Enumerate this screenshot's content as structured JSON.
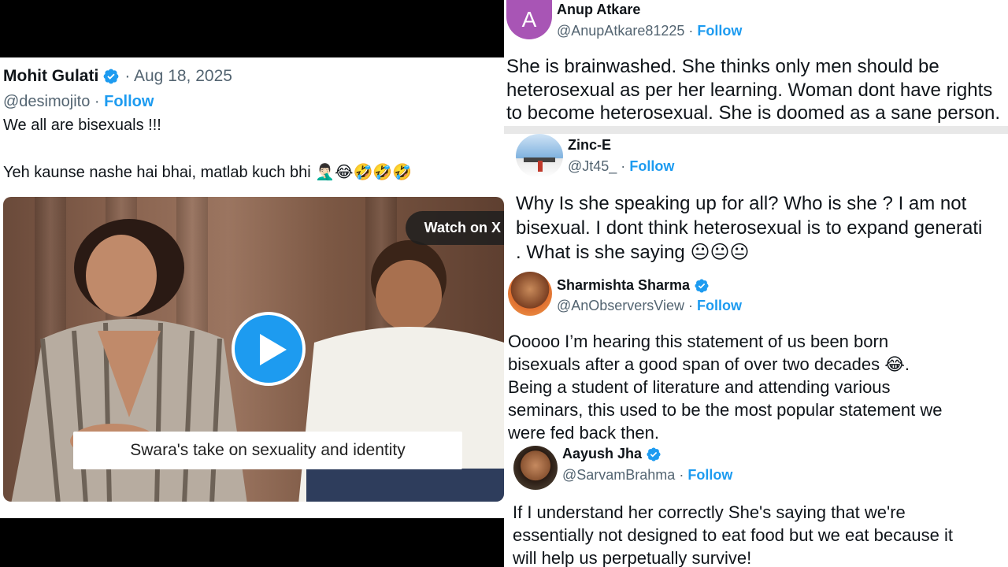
{
  "main_tweet": {
    "author": "Mohit Gulati",
    "date": "· Aug 18, 2025",
    "handle": "@desimojito",
    "follow": "Follow",
    "line1": "We all are bisexuals !!!",
    "line2": "Yeh kaunse nashe hai bhai, matlab kuch bhi",
    "line2_emoji": "🤦🏻‍♂️😂🤣🤣🤣",
    "video": {
      "watch_label": "Watch on X",
      "caption": "Swara's take on sexuality and identity"
    }
  },
  "replies": [
    {
      "avatar_letter": "A",
      "avatar_color": "#a855b5",
      "name": "Anup Atkare",
      "handle": "@AnupAtkare81225 ·",
      "follow": "Follow",
      "lines": [
        "She is brainwashed. She thinks only men should be",
        "heterosexual as per her learning. Woman dont have rights",
        "to become heterosexual.  She is doomed as a sane person."
      ]
    },
    {
      "name": "Zinc-E",
      "handle": "@Jt45_ ·",
      "follow": "Follow",
      "lines": [
        "Why Is she speaking up for all? Who is she ? I am not",
        "bisexual. I dont think heterosexual is to expand generati",
        ". What is she saying"
      ],
      "emoji": "😐😐😐"
    },
    {
      "name": "Sharmishta Sharma",
      "handle": "@AnObserversView ·",
      "follow": "Follow",
      "lines": [
        "Ooooo I’m hearing this statement of us been born",
        "bisexuals after a good span of over two decades 😂.",
        "Being a student of literature and attending various",
        "seminars, this used to be the most popular statement we",
        "were fed back then."
      ]
    },
    {
      "name": "Aayush Jha",
      "handle": "@SarvamBrahma ·",
      "follow": "Follow",
      "lines": [
        "If I understand her correctly She's saying that we're",
        "essentially not designed to eat food but we eat because it",
        "will help us perpetually survive!"
      ]
    }
  ],
  "colors": {
    "verified": "#1d9bf0",
    "link": "#1d9bf0",
    "muted": "#536471"
  }
}
